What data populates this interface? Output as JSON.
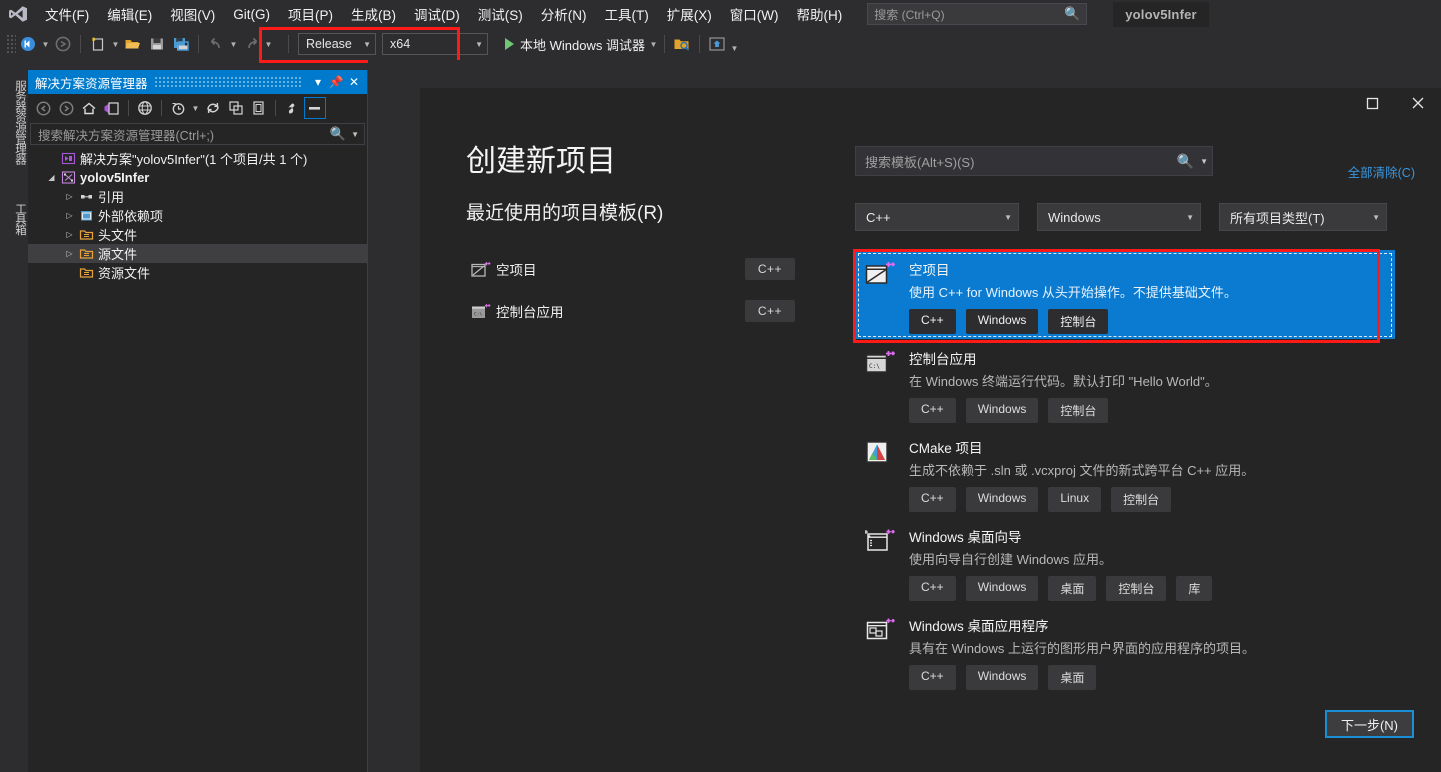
{
  "menu": {
    "logo_icon": "visual-studio-logo",
    "items": [
      {
        "label": "文件(F)"
      },
      {
        "label": "编辑(E)"
      },
      {
        "label": "视图(V)"
      },
      {
        "label": "Git(G)"
      },
      {
        "label": "项目(P)"
      },
      {
        "label": "生成(B)"
      },
      {
        "label": "调试(D)"
      },
      {
        "label": "测试(S)"
      },
      {
        "label": "分析(N)"
      },
      {
        "label": "工具(T)"
      },
      {
        "label": "扩展(X)"
      },
      {
        "label": "窗口(W)"
      },
      {
        "label": "帮助(H)"
      }
    ],
    "search_placeholder": "搜索 (Ctrl+Q)",
    "account_chip": "yolov5Infer"
  },
  "toolbar": {
    "configuration": "Release",
    "platform": "x64",
    "run_label": "本地 Windows 调试器"
  },
  "vertical_tabs": [
    {
      "label": "服务器资源管理器"
    },
    {
      "label": "工具箱"
    }
  ],
  "solution_explorer": {
    "title": "解决方案资源管理器",
    "search_placeholder": "搜索解决方案资源管理器(Ctrl+;)",
    "tree": [
      {
        "label": "解决方案\"yolov5Infer\"(1 个项目/共 1 个)",
        "level": 0,
        "bold": false,
        "expander": "none",
        "icon": "solution-icon",
        "selected": false
      },
      {
        "label": "yolov5Infer",
        "level": 0,
        "bold": true,
        "expander": "expanded",
        "icon": "project-icon",
        "selected": false
      },
      {
        "label": "引用",
        "level": 1,
        "bold": false,
        "expander": "collapsed",
        "icon": "references-icon",
        "selected": false
      },
      {
        "label": "外部依赖项",
        "level": 1,
        "bold": false,
        "expander": "collapsed",
        "icon": "external-deps-icon",
        "selected": false
      },
      {
        "label": "头文件",
        "level": 1,
        "bold": false,
        "expander": "collapsed",
        "icon": "folder-icon",
        "selected": false
      },
      {
        "label": "源文件",
        "level": 1,
        "bold": false,
        "expander": "collapsed",
        "icon": "folder-icon",
        "selected": true
      },
      {
        "label": "资源文件",
        "level": 1,
        "bold": false,
        "expander": "none",
        "icon": "folder-icon",
        "selected": false
      }
    ]
  },
  "dialog": {
    "title": "创建新项目",
    "recent_heading": "最近使用的项目模板(R)",
    "recent_templates": [
      {
        "name": "空项目",
        "tag": "C++",
        "icon": "empty-project-icon"
      },
      {
        "name": "控制台应用",
        "tag": "C++",
        "icon": "console-app-icon"
      }
    ],
    "template_search_placeholder": "搜索模板(Alt+S)(S)",
    "clear_all_label": "全部清除(C)",
    "filters": [
      {
        "name": "language-filter",
        "value": "C++"
      },
      {
        "name": "platform-filter",
        "value": "Windows"
      },
      {
        "name": "project-type-filter",
        "value": "所有项目类型(T)"
      }
    ],
    "templates": [
      {
        "name": "空项目",
        "description": "使用 C++ for Windows 从头开始操作。不提供基础文件。",
        "tags": [
          "C++",
          "Windows",
          "控制台"
        ],
        "icon": "empty-project-icon",
        "selected": true
      },
      {
        "name": "控制台应用",
        "description": "在 Windows 终端运行代码。默认打印 \"Hello World\"。",
        "tags": [
          "C++",
          "Windows",
          "控制台"
        ],
        "icon": "console-app-icon",
        "selected": false
      },
      {
        "name": "CMake 项目",
        "description": "生成不依赖于 .sln 或 .vcxproj 文件的新式跨平台 C++ 应用。",
        "tags": [
          "C++",
          "Windows",
          "Linux",
          "控制台"
        ],
        "icon": "cmake-icon",
        "selected": false
      },
      {
        "name": "Windows 桌面向导",
        "description": "使用向导自行创建 Windows 应用。",
        "tags": [
          "C++",
          "Windows",
          "桌面",
          "控制台",
          "库"
        ],
        "icon": "desktop-wizard-icon",
        "selected": false
      },
      {
        "name": "Windows 桌面应用程序",
        "description": "具有在 Windows 上运行的图形用户界面的应用程序的项目。",
        "tags": [
          "C++",
          "Windows",
          "桌面"
        ],
        "icon": "desktop-app-icon",
        "selected": false
      }
    ],
    "next_button": "下一步(N)",
    "window_controls": {
      "maximize": "□",
      "close": "✕"
    }
  },
  "colors": {
    "accent_blue": "#007acc",
    "selection_blue": "#0a7bd1",
    "link_blue": "#3a96dd",
    "highlight_red": "#ff1a1a",
    "panel_bg": "#252526",
    "app_bg": "#2d2d30"
  }
}
